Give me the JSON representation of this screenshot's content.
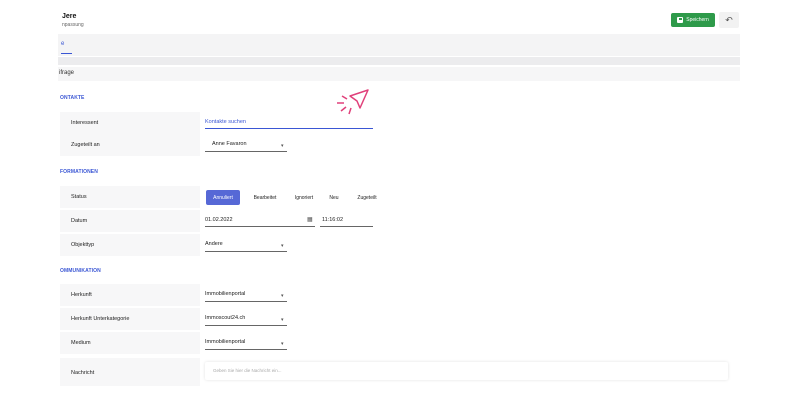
{
  "header": {
    "title": "Jere",
    "subtitle": "npassung",
    "save_label": "Speichern",
    "undo_symbol": "↶"
  },
  "tabs": {
    "active_label": "e"
  },
  "subheader": {
    "label": "ifrage"
  },
  "sections": {
    "kontakte": "ONTAKTE",
    "informationen": "FORMATIONEN",
    "kommunikation": "OMMUNIKATION"
  },
  "fields": {
    "interessent": {
      "label": "Interessent",
      "placeholder": "Kontakte suchen"
    },
    "zugeteilt": {
      "label": "Zugeteilt an",
      "value": "Anne Favaron"
    },
    "status": {
      "label": "Status",
      "options": [
        "Annuliert",
        "Bearbeitet",
        "Ignoriert",
        "Neu",
        "Zugeteilt"
      ],
      "selected": "Annuliert"
    },
    "datum": {
      "label": "Datum",
      "date": "01.02.2022",
      "time": "11:16:02"
    },
    "objekttyp": {
      "label": "Objekttyp",
      "value": "Andere"
    },
    "herkunft": {
      "label": "Herkunft",
      "value": "Immobilienportal"
    },
    "herkunft_unterkategorie": {
      "label": "Herkunft Unterkategorie",
      "value": "Immoscout24.ch"
    },
    "medium": {
      "label": "Medium",
      "value": "Immobilienportal"
    },
    "nachricht": {
      "label": "Nachricht",
      "placeholder": "Geben Sie hier die Nachricht ein..."
    }
  },
  "colors": {
    "accent": "#3a56d4",
    "save": "#2e9a4a",
    "cursor": "#e0407a"
  }
}
